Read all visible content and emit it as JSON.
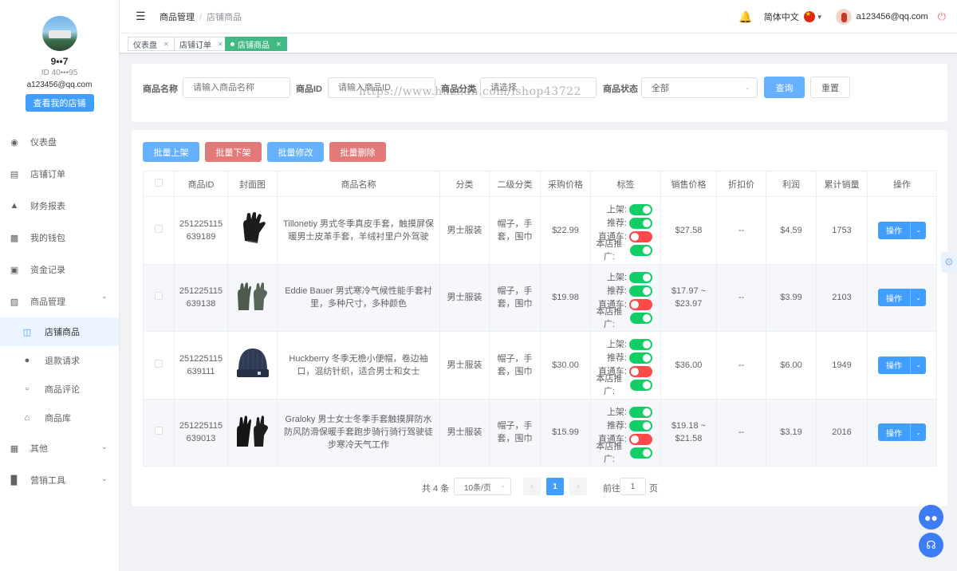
{
  "sidebar": {
    "profile": {
      "name": "9••7",
      "id_text": "ID 40•••95",
      "email": "a123456@qq.com",
      "shop_button": "查看我的店铺"
    },
    "items": [
      {
        "label": "仪表盘",
        "icon": "dashboard-icon"
      },
      {
        "label": "店铺订单",
        "icon": "clipboard-icon"
      },
      {
        "label": "财务报表",
        "icon": "chart-icon"
      },
      {
        "label": "我的钱包",
        "icon": "wallet-icon"
      },
      {
        "label": "资金记录",
        "icon": "document-icon"
      },
      {
        "label": "商品管理",
        "icon": "briefcase-icon"
      }
    ],
    "sub_items": [
      {
        "label": "店铺商品",
        "icon": "shopping-bag-icon"
      },
      {
        "label": "退款请求",
        "icon": "alert-circle-icon"
      },
      {
        "label": "商品评论",
        "icon": "chat-icon"
      },
      {
        "label": "商品库",
        "icon": "home-icon"
      }
    ],
    "items_bottom": [
      {
        "label": "其他",
        "icon": "grid-icon"
      },
      {
        "label": "营销工具",
        "icon": "bar-chart-icon"
      }
    ]
  },
  "header": {
    "breadcrumb": [
      "商品管理",
      "店铺商品"
    ],
    "language": "简体中文",
    "user_email": "a123456@qq.com"
  },
  "tabs": [
    {
      "label": "仪表盘"
    },
    {
      "label": "店铺订单"
    },
    {
      "label": "店铺商品",
      "active": true
    }
  ],
  "search": {
    "name_label": "商品名称",
    "name_placeholder": "请输入商品名称",
    "id_label": "商品ID",
    "id_placeholder": "请输入商品ID",
    "category_label": "商品分类",
    "category_placeholder": "请选择",
    "status_label": "商品状态",
    "status_value": "全部",
    "query_button": "查询",
    "reset_button": "重置",
    "watermark": "https://www.huzhan.com/ishop43722"
  },
  "batch": {
    "up": "批量上架",
    "down": "批量下架",
    "edit": "批量修改",
    "delete": "批量删除"
  },
  "table": {
    "headers": [
      "商品ID",
      "封面图",
      "商品名称",
      "分类",
      "二级分类",
      "采购价格",
      "标签",
      "销售价格",
      "折扣价",
      "利润",
      "累计销量",
      "操作"
    ],
    "tag_labels": [
      "上架:",
      "推荐:",
      "直通车:",
      "本店推广:"
    ],
    "op_label": "操作",
    "rows": [
      {
        "id_line1": "251225115",
        "id_line2": "639189",
        "name": "Tillonetiy 男式冬季真皮手套，触摸屏保暖男士皮革手套，羊绒衬里户外驾驶",
        "category": "男士服装",
        "sub_category": "帽子，手套，围巾",
        "purchase": "$22.99",
        "tags": [
          true,
          true,
          false,
          true
        ],
        "sale": "$27.58",
        "discount": "--",
        "profit": "$4.59",
        "sold": "1753",
        "image": "leather-glove"
      },
      {
        "id_line1": "251225115",
        "id_line2": "639138",
        "name": "Eddie Bauer 男式寒冷气候性能手套衬里，多种尺寸，多种颜色",
        "category": "男士服装",
        "sub_category": "帽子，手套，围巾",
        "purchase": "$19.98",
        "tags": [
          true,
          true,
          false,
          true
        ],
        "sale": "$17.97 ~ $23.97",
        "discount": "--",
        "profit": "$3.99",
        "sold": "2103",
        "image": "green-glove"
      },
      {
        "id_line1": "251225115",
        "id_line2": "639111",
        "name": "Huckberry 冬季无檐小便帽，卷边袖口，混纺针织，适合男士和女士",
        "category": "男士服装",
        "sub_category": "帽子，手套，围巾",
        "purchase": "$30.00",
        "tags": [
          true,
          true,
          false,
          true
        ],
        "sale": "$36.00",
        "discount": "--",
        "profit": "$6.00",
        "sold": "1949",
        "image": "beanie"
      },
      {
        "id_line1": "251225115",
        "id_line2": "639013",
        "name": "Graloky 男士女士冬季手套触摸屏防水防风防滑保暖手套跑步骑行骑行驾驶徒步寒冷天气工作",
        "category": "男士服装",
        "sub_category": "帽子，手套，围巾",
        "purchase": "$15.99",
        "tags": [
          true,
          true,
          false,
          true
        ],
        "sale": "$19.18 ~ $21.58",
        "discount": "--",
        "profit": "$3.19",
        "sold": "2016",
        "image": "black-glove"
      }
    ]
  },
  "pagination": {
    "total": "共 4 条",
    "page_size": "10条/页",
    "current": "1",
    "goto_label": "前往",
    "goto_value": "1",
    "goto_unit": "页"
  }
}
